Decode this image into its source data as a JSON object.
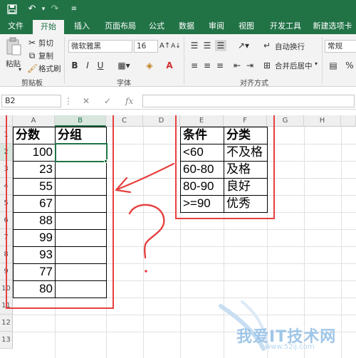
{
  "quick_access": {
    "save_icon": "save-icon",
    "undo_icon": "undo-icon",
    "redo_icon": "redo-icon",
    "customize_icon": "customize-icon"
  },
  "tabs": [
    "文件",
    "开始",
    "插入",
    "页面布局",
    "公式",
    "数据",
    "审阅",
    "视图",
    "开发工具",
    "新建选项卡"
  ],
  "active_tab": "开始",
  "ribbon": {
    "paste_label": "粘贴",
    "cut_label": "剪切",
    "copy_label": "复制",
    "format_painter_label": "格式刷",
    "clipboard_group": "剪贴板",
    "font_name": "微软雅黑",
    "font_size": "16",
    "font_group": "字体",
    "bold": "B",
    "italic": "I",
    "underline": "U",
    "font_color_glyph": "A",
    "wrap_text_label": "自动换行",
    "merge_label": "合并后居中",
    "alignment_group": "对齐方式",
    "number_format": "常规",
    "percent_glyph": "%"
  },
  "formula_bar": {
    "name_box": "B2",
    "formula": ""
  },
  "columns": [
    "A",
    "B",
    "C",
    "D",
    "E",
    "F",
    "G",
    "H"
  ],
  "rows": [
    "1",
    "2",
    "3",
    "4",
    "5",
    "6",
    "7",
    "8",
    "9",
    "10",
    "11",
    "12",
    "13"
  ],
  "table1": {
    "header_a": "分数",
    "header_b": "分组",
    "scores": [
      "100",
      "23",
      "55",
      "67",
      "88",
      "99",
      "93",
      "77",
      "80"
    ]
  },
  "table2": {
    "header_e": "条件",
    "header_f": "分类",
    "rows": [
      {
        "condition": "<60",
        "category": "不及格"
      },
      {
        "condition": "60-80",
        "category": "及格"
      },
      {
        "condition": "80-90",
        "category": "良好"
      },
      {
        "condition": ">=90",
        "category": "优秀"
      }
    ]
  },
  "watermark": {
    "text": "我爱IT技术网",
    "url": "www.52ij.com"
  },
  "colors": {
    "excel_green": "#217346",
    "annotation_red": "#e6413f"
  }
}
